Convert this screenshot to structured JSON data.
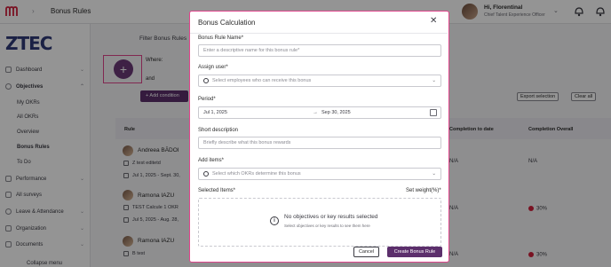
{
  "topbar": {
    "breadcrumb": "Bonus Rules",
    "user_greeting": "Hi, Florentinal",
    "user_role": "Chief Talent Experience Officer"
  },
  "sidebar": {
    "brand": "ZTEC",
    "items": [
      {
        "label": "Dashboard"
      },
      {
        "label": "Objectives"
      },
      {
        "label": "Performance"
      },
      {
        "label": "All surveys"
      },
      {
        "label": "Leave & Attendance"
      },
      {
        "label": "Organization"
      },
      {
        "label": "Documents"
      }
    ],
    "sub_items": [
      {
        "label": "My OKRs"
      },
      {
        "label": "All OKRs"
      },
      {
        "label": "Overview"
      },
      {
        "label": "Bonus Rules"
      },
      {
        "label": "To Do"
      }
    ],
    "collapse": "Collapse menu"
  },
  "filters": {
    "title": "Filter Bonus Rules",
    "where": "Where:",
    "and": "and",
    "add_condition": "+ Add condition",
    "export": "Export selection",
    "clear": "Clear all"
  },
  "table": {
    "headers": {
      "rule": "Rule",
      "completion_to_date": "Completion to date",
      "completion_overall": "Completion Overall"
    },
    "rows": [
      {
        "name": "Andreea BĂDOI",
        "rule": "Z test editetd",
        "period": "Jul 1, 2025 - Sept. 30,",
        "to_date": "N/A",
        "overall": "N/A"
      },
      {
        "name": "Ramona IAZU",
        "rule": "TEST Calcule 1 OKR",
        "period": "Jul 5, 2025 - Aug. 28,",
        "to_date": "N/A",
        "overall": "30%"
      },
      {
        "name": "Ramona IAZU",
        "rule": "B test",
        "period": "",
        "to_date": "N/A",
        "overall": "30%"
      }
    ]
  },
  "modal": {
    "title": "Bonus Calculation",
    "name_label": "Bonus Rule Name*",
    "name_placeholder": "Enter a descriptive name for this bonus rule*",
    "assign_label": "Assign user*",
    "assign_placeholder": "Select employees who can receive this bonus",
    "period_label": "Period*",
    "period_start": "Jul 1, 2025",
    "period_end": "Sep 30, 2025",
    "short_desc_label": "Short description",
    "short_desc_placeholder": "Briefly describe what this bonus rewards",
    "add_items_label": "Add items*",
    "add_items_placeholder": "Select which OKRs determine this bonus",
    "selected_items_label": "Selected Items*",
    "set_weight_label": "Set weight(%)*",
    "empty_title": "No objectives or key results selected",
    "empty_sub": "Select objectives or key results to see them here",
    "cancel": "Cancel",
    "create": "Create Bonus Rule"
  }
}
